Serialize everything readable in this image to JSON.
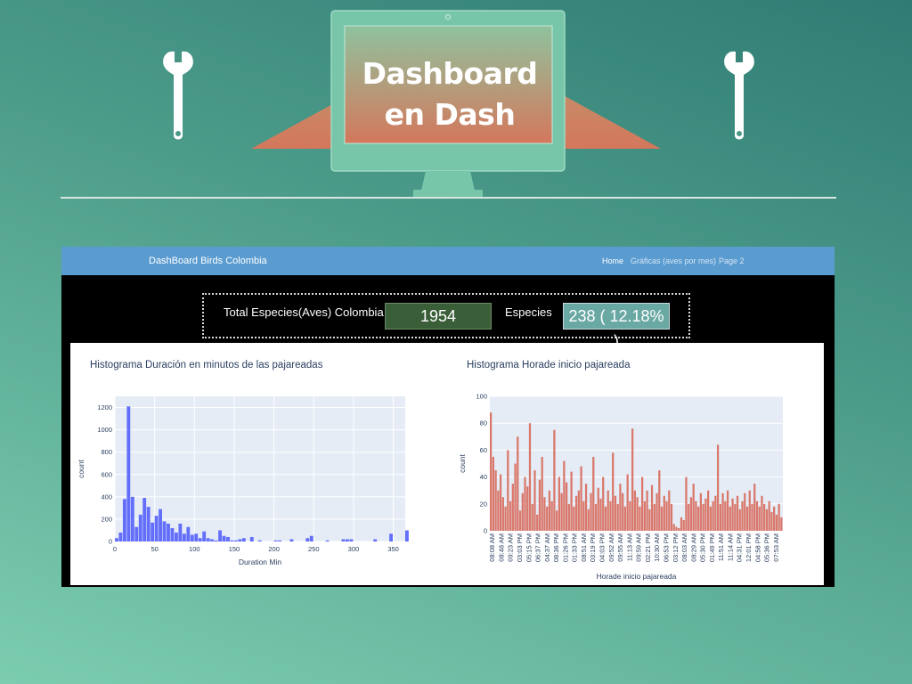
{
  "hero": {
    "title_line1": "Dashboard",
    "title_line2": "en Dash",
    "icons": [
      "wrench-icon",
      "monitor-icon",
      "wrench-icon"
    ]
  },
  "navbar": {
    "brand": "DashBoard Birds Colombia",
    "links": [
      "Home",
      "Gráficas (aves por mes)",
      "Page 2"
    ],
    "active": "Home"
  },
  "stats": {
    "total_label": "Total Especies(Aves) Colombia",
    "total_value": "1954",
    "especies_label": "Especies",
    "especies_value": "238 ( 12.18% )"
  },
  "colors": {
    "navbar": "#5a9bd0",
    "histogram_bars": "#636efa",
    "hora_bars": "#d9776a",
    "plot_bg": "#e5ecf6"
  },
  "chart_data": [
    {
      "type": "bar",
      "title": "Histograma Duración en minutos de las pajareadas",
      "xlabel": "Duration Min",
      "ylabel": "count",
      "xlim": [
        0,
        365
      ],
      "ylim": [
        0,
        1300
      ],
      "xticks": [
        0,
        50,
        100,
        150,
        200,
        250,
        300,
        350
      ],
      "yticks": [
        0,
        200,
        400,
        600,
        800,
        1000,
        1200
      ],
      "bin_width": 5,
      "values": [
        30,
        80,
        380,
        1210,
        400,
        130,
        240,
        390,
        310,
        170,
        230,
        290,
        180,
        160,
        120,
        80,
        160,
        70,
        130,
        60,
        70,
        30,
        90,
        30,
        20,
        10,
        100,
        50,
        40,
        10,
        10,
        20,
        30,
        0,
        40,
        0,
        10,
        0,
        0,
        0,
        10,
        10,
        0,
        0,
        20,
        0,
        0,
        0,
        30,
        50,
        0,
        0,
        0,
        10,
        0,
        0,
        0,
        20,
        20,
        20,
        0,
        0,
        0,
        0,
        0,
        20,
        0,
        0,
        0,
        70,
        0,
        0,
        0,
        100
      ]
    },
    {
      "type": "bar",
      "title": "Histograma Horade inicio pajareada",
      "xlabel": "Horade inicio pajareada",
      "ylabel": "count",
      "ylim": [
        0,
        100
      ],
      "yticks": [
        0,
        20,
        40,
        60,
        80,
        100
      ],
      "categories": [
        "08:08 AM",
        "08:48 AM",
        "09:23 AM",
        "03:03 PM",
        "05:15 PM",
        "06:37 PM",
        "04:37 AM",
        "08:36 PM",
        "01:26 PM",
        "01:33 PM",
        "08:51 AM",
        "03:19 PM",
        "04:03 PM",
        "09:52 AM",
        "09:55 AM",
        "11:13 AM",
        "09:59 AM",
        "02:21 PM",
        "10:30 AM",
        "06:53 PM",
        "03:12 PM",
        "08:03 AM",
        "08:29 AM",
        "05:30 PM",
        "01:49 PM",
        "11:51 AM",
        "11:14 AM",
        "04:31 PM",
        "12:01 PM",
        "04:58 PM",
        "05:36 PM",
        "07:53 AM"
      ],
      "values": [
        88,
        55,
        45,
        30,
        42,
        25,
        18,
        60,
        22,
        35,
        50,
        70,
        15,
        28,
        40,
        33,
        80,
        20,
        45,
        12,
        38,
        55,
        25,
        18,
        30,
        22,
        75,
        15,
        40,
        28,
        52,
        36,
        20,
        44,
        18,
        26,
        30,
        48,
        22,
        35,
        16,
        28,
        55,
        20,
        32,
        24,
        40,
        18,
        30,
        22,
        58,
        26,
        20,
        35,
        28,
        18,
        42,
        22,
        76,
        30,
        25,
        18,
        40,
        22,
        30,
        16,
        34,
        20,
        28,
        45,
        18,
        26,
        22,
        30,
        20,
        5,
        3,
        2,
        10,
        8,
        40,
        20,
        25,
        35,
        22,
        18,
        28,
        20,
        24,
        30,
        18,
        22,
        26,
        64,
        20,
        28,
        22,
        30,
        18,
        24,
        20,
        26,
        16,
        22,
        28,
        18,
        30,
        20,
        35,
        22,
        18,
        26,
        20,
        16,
        22,
        14,
        18,
        12,
        20,
        10
      ]
    }
  ]
}
